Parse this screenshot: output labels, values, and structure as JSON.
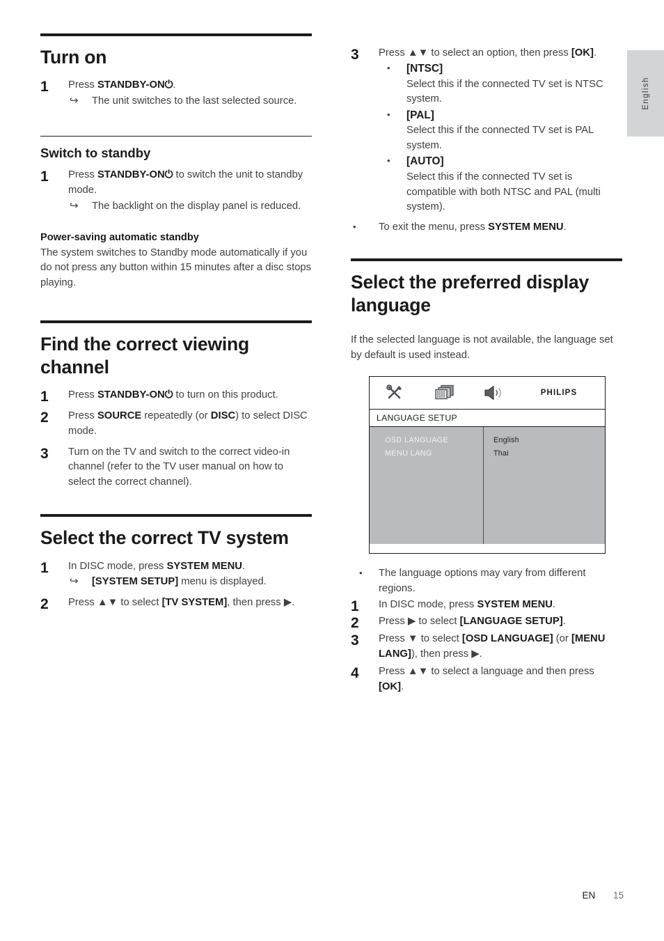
{
  "side_tab": {
    "label": "English"
  },
  "footer": {
    "locale": "EN",
    "page_number": "15"
  },
  "left_column": {
    "section_turn_on": {
      "heading": "Turn on",
      "step1": {
        "num": "1",
        "pre": "Press ",
        "bold": "STANDBY-ON⏻",
        "post": "."
      },
      "note1": {
        "arrow": "↪",
        "text": "The unit switches to the last selected source."
      }
    },
    "section_switch_standby": {
      "heading": "Switch to standby",
      "step1": {
        "num": "1",
        "pre": "Press ",
        "bold": "STANDBY-ON⏻",
        "post": " to switch the unit to standby mode."
      },
      "note1": {
        "arrow": "↪",
        "text": "The backlight on the display panel is reduced."
      },
      "subheading": "Power-saving automatic standby",
      "paragraph": "The system switches to Standby mode automatically if you do not press any button within 15 minutes after a disc stops playing."
    },
    "section_viewing_channel": {
      "heading": "Find the correct viewing channel",
      "step1": {
        "num": "1",
        "pre": "Press ",
        "bold": "STANDBY-ON⏻",
        "post": " to turn on this product."
      },
      "step2": {
        "num": "2",
        "pre": "Press ",
        "bold": "SOURCE",
        "mid": " repeatedly (or ",
        "bold2": "DISC",
        "post": ") to select DISC mode."
      },
      "step3": {
        "num": "3",
        "text": "Turn on the TV and switch to the correct video-in channel (refer to the TV user manual on how to select the correct channel)."
      }
    },
    "section_tv_system": {
      "heading": "Select the correct TV system",
      "step1": {
        "num": "1",
        "pre": "In DISC mode, press ",
        "bold": "SYSTEM MENU",
        "post": "."
      },
      "note1": {
        "arrow": "↪",
        "bold": "[SYSTEM SETUP]",
        "text": " menu is displayed."
      },
      "step2": {
        "num": "2",
        "pre": "Press ▲▼ to select ",
        "bold": "[TV SYSTEM]",
        "post": ", then press ▶."
      }
    }
  },
  "right_column": {
    "tv_system_continued": {
      "step3": {
        "num": "3",
        "pre": "Press ▲▼ to select an option, then press ",
        "bold": "[OK]",
        "post": "."
      },
      "options": [
        {
          "name": "[NTSC]",
          "desc": "Select this if the connected TV set is NTSC system."
        },
        {
          "name": "[PAL]",
          "desc": "Select this if the connected TV set is PAL system."
        },
        {
          "name": "[AUTO]",
          "desc": "Select this if the connected TV set is compatible with both NTSC and PAL (multi system)."
        }
      ],
      "exit_note": {
        "pre": "To exit the menu, press ",
        "bold": "SYSTEM MENU",
        "post": "."
      }
    },
    "section_display_language": {
      "heading": "Select the preferred display language",
      "paragraph": "If the selected language is not available, the language set by default is used instead.",
      "osd": {
        "icons": [
          "tools-icon",
          "display-icon",
          "speaker-icon"
        ],
        "brand": "PHILIPS",
        "title": "LANGUAGE SETUP",
        "menu_items": [
          "OSD LANGUAGE",
          "MENU LANG"
        ],
        "menu_values": [
          "English",
          "Thai"
        ]
      },
      "note_bullet": "The language options may vary from different regions.",
      "steps": [
        {
          "num": "1",
          "pre": "In DISC mode, press ",
          "bold": "SYSTEM MENU",
          "post": "."
        },
        {
          "num": "2",
          "pre": "Press ▶ to select ",
          "bold": "[LANGUAGE SETUP]",
          "post": "."
        },
        {
          "num": "3",
          "pre": "Press ▼ to select ",
          "bold": "[OSD LANGUAGE]",
          "mid": " (or ",
          "bold2": "[MENU LANG]",
          "post": "), then press ▶."
        },
        {
          "num": "4",
          "pre": "Press ▲▼ to select a language and then press ",
          "bold": "[OK]",
          "post": "."
        }
      ]
    }
  }
}
